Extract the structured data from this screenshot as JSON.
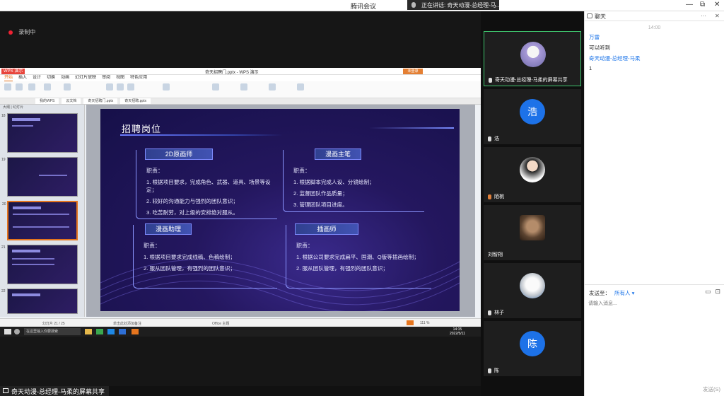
{
  "app": {
    "title": "腾讯会议",
    "speaking": "正在讲话: 奇天动漫-总经理-马...",
    "window_controls": [
      "—",
      "⧉",
      "✕"
    ],
    "recording": "录制中"
  },
  "shared_screen": {
    "label": "奇天动漫-总经理-马柔的屏幕共享",
    "wps": {
      "logo": "WPS 演示",
      "doc_title": "奇天招聘门.pptx - WPS 演示",
      "login": "未登录",
      "menu": [
        "开始",
        "插入",
        "设计",
        "切换",
        "动画",
        "幻灯片放映",
        "审阅",
        "视图",
        "特色应用"
      ],
      "tabs": [
        "我的WPS",
        "云文档",
        "奇天招聘门.pptx",
        "奇天招聘.pptx"
      ],
      "thumb_tabs": "大纲 | 幻灯片",
      "thumb_numbers": [
        "18",
        "19",
        "20",
        "21",
        "22"
      ],
      "status": {
        "slide": "幻灯片 21 / 25",
        "theme": "Office 主题",
        "notes": "单击此处添加备注",
        "zoom": "111 %"
      }
    },
    "slide": {
      "title": "招聘岗位",
      "cards": [
        {
          "head": "2D原画师",
          "label": "职责：",
          "items": [
            "1. 根据项目要求，完成角色、武器、道具、场景等设定；",
            "2. 较好的沟通能力与强烈的团队意识；",
            "3. 吃苦耐劳，对上级的安排绝对服从。"
          ]
        },
        {
          "head": "漫画主笔",
          "label": "职责：",
          "items": [
            "1. 根据脚本完成人设、分镜绘制；",
            "2. 监督团队作品质量；",
            "3. 管理团队项目进度。"
          ]
        },
        {
          "head": "漫画助理",
          "label": "职责：",
          "items": [
            "1. 根据项目要求完成线稿、色稿绘制；",
            "2. 服从团队管理，有强烈的团队意识；"
          ]
        },
        {
          "head": "插画师",
          "label": "职责：",
          "items": [
            "1. 根据公司要求完成扁平、国潮、Q版等插画绘制；",
            "2. 服从团队管理，有强烈的团队意识；"
          ]
        }
      ]
    },
    "taskbar": {
      "search": "在这里输入你要搜索",
      "time": "14:15",
      "date": "2022/5/11"
    }
  },
  "participants": [
    {
      "name": "奇天动漫-总经理-马柔的屏幕共享",
      "avatar": "",
      "muted": false
    },
    {
      "name": "浩",
      "avatar": "浩",
      "muted": false
    },
    {
      "name": "陌桃",
      "avatar": "",
      "muted": true
    },
    {
      "name": "刘智翔",
      "avatar": "",
      "muted": false
    },
    {
      "name": "林子",
      "avatar": "",
      "muted": false
    },
    {
      "name": "陈",
      "avatar": "陈",
      "muted": false
    }
  ],
  "chat": {
    "title": "聊天",
    "time": "14:00",
    "messages": [
      {
        "sender": "万雷",
        "body": "可以听到"
      },
      {
        "sender": "奇天动漫-总经理-马柔",
        "body": "1"
      }
    ],
    "send_to_label": "发送至：",
    "send_to_value": "所有人 ▾",
    "input_placeholder": "请输入消息...",
    "send_button": "发送(S)"
  },
  "colors": {
    "accent": "#1a73e8",
    "speaking_border": "#3ec46d",
    "slide_bg": "#24175f",
    "wps_orange": "#e5751e"
  }
}
